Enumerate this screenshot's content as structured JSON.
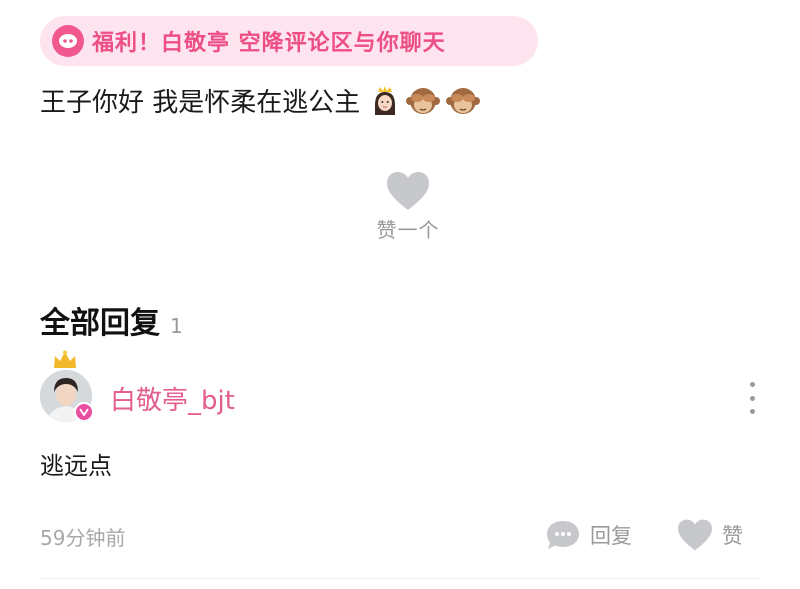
{
  "promo": {
    "text": "福利！白敬亭 空降评论区与你聊天"
  },
  "post": {
    "text": "王子你好 我是怀柔在逃公主",
    "emojis": [
      "princess-emoji",
      "see-no-evil-monkey-emoji",
      "see-no-evil-monkey-emoji"
    ]
  },
  "like_one": {
    "label": "赞一个"
  },
  "replies": {
    "title": "全部回复",
    "count": "1"
  },
  "comment": {
    "username": "白敬亭_bjt",
    "text": "逃远点",
    "time": "59分钟前",
    "reply_label": "回复",
    "like_label": "赞"
  },
  "colors": {
    "accent": "#ee4e86",
    "promo_bg": "#fde4ee",
    "username": "#e35d8f",
    "muted": "#9a9a9a"
  }
}
